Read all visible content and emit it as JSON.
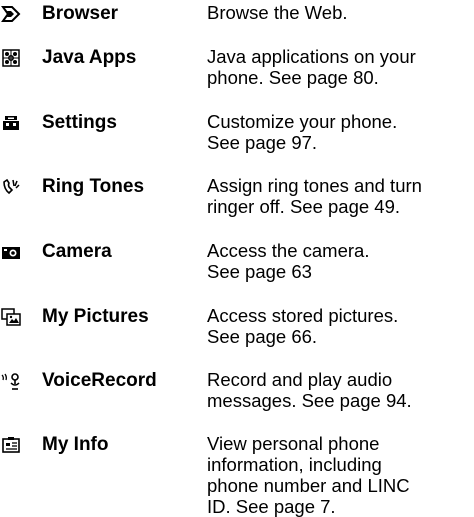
{
  "menu_items": [
    {
      "icon": "browser-icon",
      "name": "Browser",
      "description": "Browse the Web."
    },
    {
      "icon": "java-apps-icon",
      "name": "Java Apps",
      "description": "Java applications on your\nphone. See page 80."
    },
    {
      "icon": "settings-icon",
      "name": "Settings",
      "description": "Customize your phone.\nSee page 97."
    },
    {
      "icon": "ring-tones-icon",
      "name": "Ring Tones",
      "description": "Assign ring tones and turn\nringer off. See page 49."
    },
    {
      "icon": "camera-icon",
      "name": "Camera",
      "description": "Access the camera.\nSee page 63"
    },
    {
      "icon": "my-pictures-icon",
      "name": "My Pictures",
      "description": "Access stored pictures.\nSee page 66."
    },
    {
      "icon": "voice-record-icon",
      "name": "VoiceRecord",
      "description": "Record and play audio\nmessages. See page 94."
    },
    {
      "icon": "my-info-icon",
      "name": "My Info",
      "description": "View personal phone\ninformation, including\nphone number and LINC\nID. See page 7."
    }
  ]
}
